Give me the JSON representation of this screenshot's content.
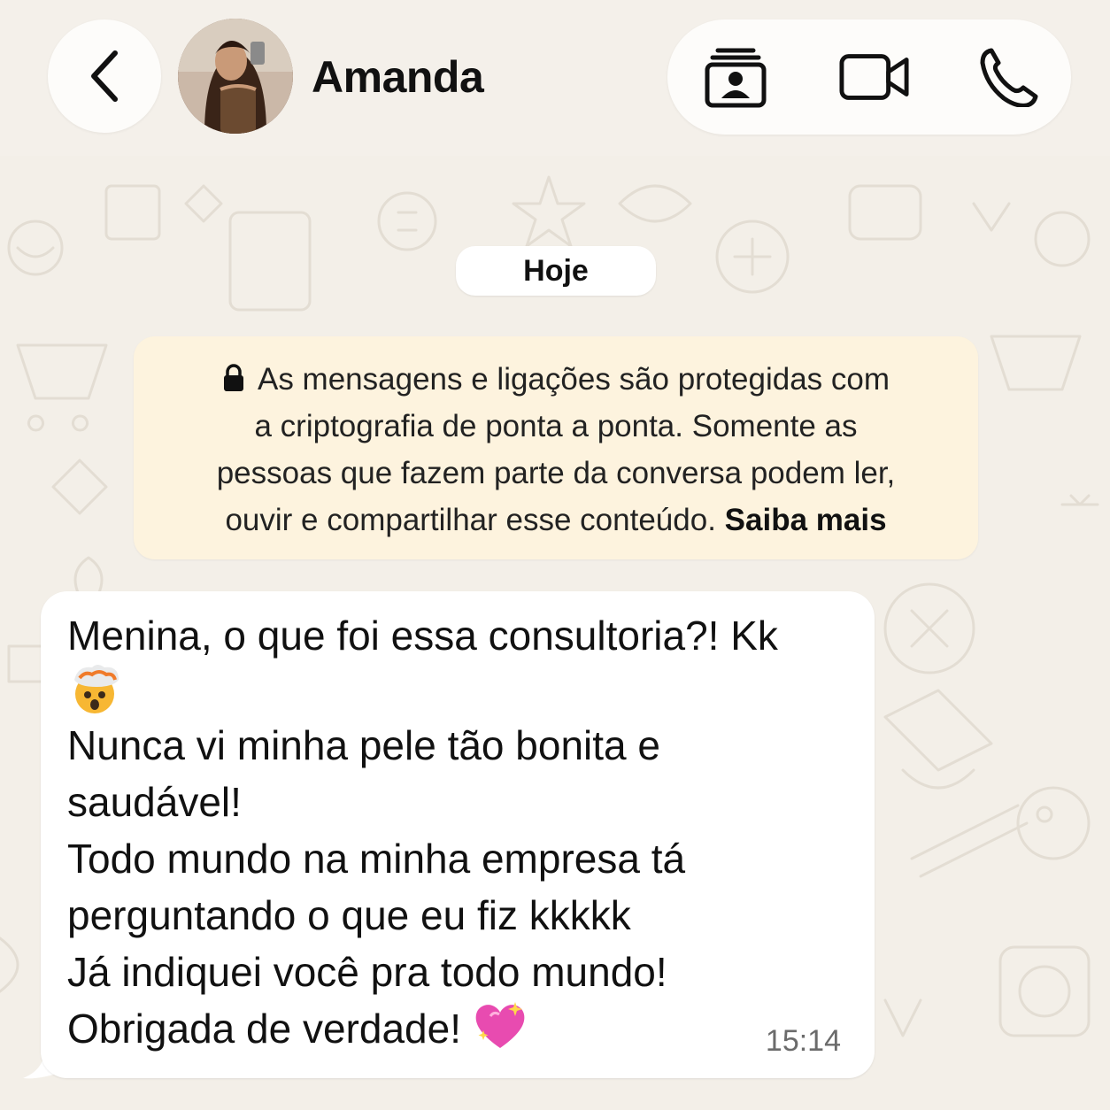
{
  "header": {
    "contact_name": "Amanda",
    "back_icon": "chevron-left-icon",
    "actions": [
      {
        "name": "contact-card-icon"
      },
      {
        "name": "video-call-icon"
      },
      {
        "name": "voice-call-icon"
      }
    ]
  },
  "chat": {
    "date_label": "Hoje",
    "encryption_notice": {
      "lines": [
        "As mensagens e ligações são protegidas com",
        "a criptografia de ponta a ponta. Somente as",
        "pessoas que fazem parte da conversa podem ler,",
        "ouvir e compartilhar esse conteúdo."
      ],
      "link": "Saiba mais"
    },
    "message": {
      "line1": "Menina, o que foi essa consultoria?! Kk",
      "line1_emoji": "exploding-head-emoji",
      "line2": "Nunca vi minha pele tão bonita e",
      "line3": "saudável!",
      "line4": "Todo mundo na minha empresa tá",
      "line5": "perguntando o que eu fiz kkkkk",
      "line6": "Já indiquei você pra todo mundo!",
      "line7": "Obrigada de verdade!",
      "line7_emoji": "sparkling-heart-emoji",
      "time": "15:14"
    }
  },
  "colors": {
    "background": "#f3efe8",
    "notice_bg": "#fdf3de",
    "bubble_bg": "#ffffff"
  }
}
